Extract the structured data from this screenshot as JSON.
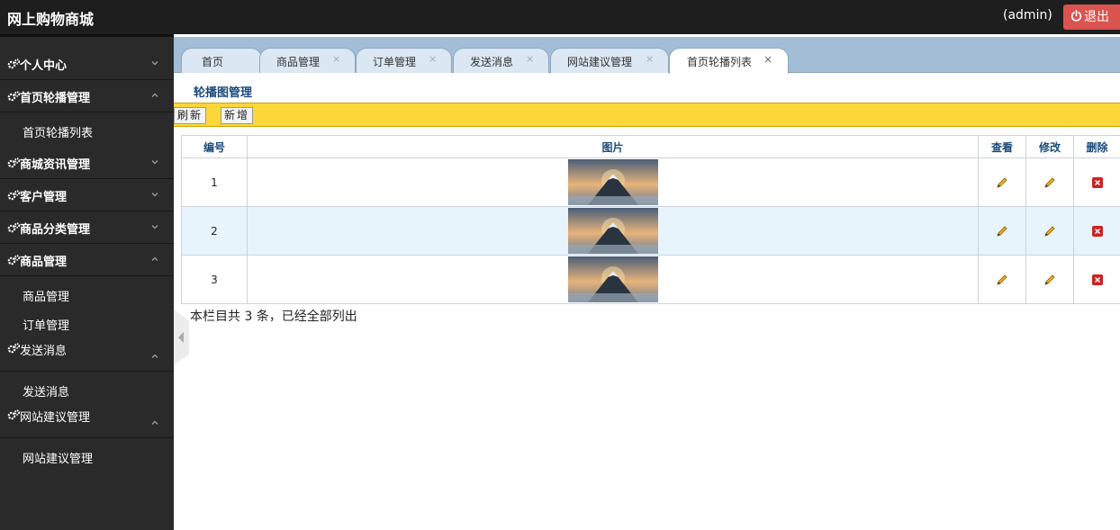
{
  "header": {
    "brand": "网上购物商城",
    "user": "(admin)",
    "logout_label": "退出"
  },
  "sidebar": {
    "groups": [
      {
        "label": "个人中心",
        "expanded": false,
        "items": []
      },
      {
        "label": "首页轮播管理",
        "expanded": true,
        "items": [
          "首页轮播列表"
        ]
      },
      {
        "label": "商城资讯管理",
        "expanded": false,
        "items": []
      },
      {
        "label": "客户管理",
        "expanded": false,
        "items": []
      },
      {
        "label": "商品分类管理",
        "expanded": false,
        "items": []
      },
      {
        "label": "商品管理",
        "expanded": true,
        "items": [
          "商品管理",
          "订单管理"
        ]
      },
      {
        "label": "发送消息",
        "expanded": true,
        "items": [
          "发送消息"
        ]
      },
      {
        "label": "网站建议管理",
        "expanded": true,
        "items": [
          "网站建议管理"
        ]
      }
    ]
  },
  "tabs": [
    {
      "label": "首页",
      "closable": false,
      "active": false
    },
    {
      "label": "商品管理",
      "closable": true,
      "active": false
    },
    {
      "label": "订单管理",
      "closable": true,
      "active": false
    },
    {
      "label": "发送消息",
      "closable": true,
      "active": false
    },
    {
      "label": "网站建议管理",
      "closable": true,
      "active": false
    },
    {
      "label": "首页轮播列表",
      "closable": true,
      "active": true
    }
  ],
  "content": {
    "title": "轮播图管理",
    "toolbar": {
      "refresh_label": "刷新",
      "add_label": "新增"
    },
    "table": {
      "columns": [
        "编号",
        "图片",
        "查看",
        "修改",
        "删除"
      ],
      "rows": [
        {
          "id": "1"
        },
        {
          "id": "2"
        },
        {
          "id": "3"
        }
      ]
    },
    "summary": "本栏目共 3 条，已经全部列出"
  },
  "colors": {
    "topbar": "#1e1e1e",
    "sidebar": "#2a2a2a",
    "logout": "#d9534f",
    "tabbar": "#a3bdd6",
    "toolbar": "#fcd73a",
    "header_text": "#1a4a7a",
    "row_alt": "#e8f4fc",
    "delete": "#cc2222"
  },
  "icons": {
    "sidebar_group": "gear-icon",
    "expanded": "chevron-up-icon",
    "collapsed": "chevron-down-icon",
    "view": "pencil-icon",
    "edit": "pencil-icon",
    "delete": "delete-icon",
    "logout": "power-icon"
  }
}
